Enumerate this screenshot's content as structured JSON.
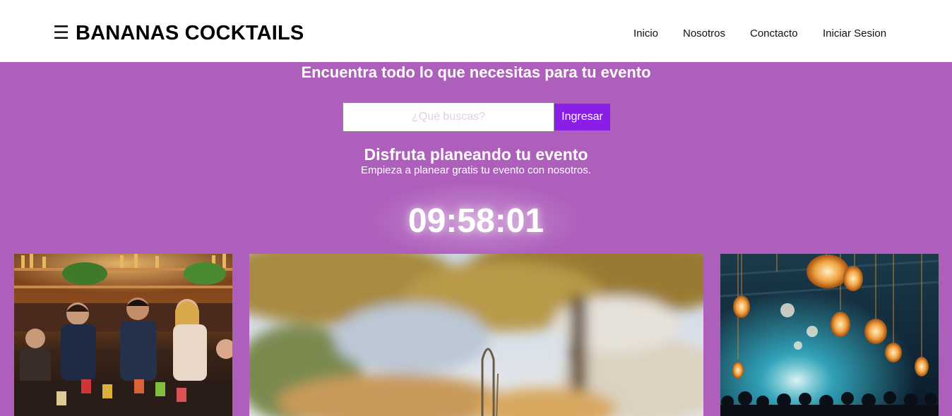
{
  "header": {
    "menu_icon": "hamburger-menu-icon",
    "brand": "BANANAS COCKTAILS",
    "nav": [
      {
        "label": "Inicio"
      },
      {
        "label": "Nosotros"
      },
      {
        "label": "Conctacto"
      },
      {
        "label": "Iniciar Sesion"
      }
    ]
  },
  "hero": {
    "title": "Encuentra todo lo que necesitas para tu evento",
    "search": {
      "placeholder": "¿Qué buscas?",
      "value": "",
      "button_label": "Ingresar"
    },
    "subtitle": "Disfruta planeando tu evento",
    "description": "Empieza a planear gratis tu evento con nosotros.",
    "countdown": "09:58:01"
  },
  "gallery": [
    {
      "alt": "Grupo de amigos brindando con cócteles en un bar"
    },
    {
      "alt": "Exterior con árbol y columpio desenfocado"
    },
    {
      "alt": "Fiesta en salón con luces colgantes y luz azul"
    }
  ],
  "colors": {
    "background": "#ae5fbc",
    "header": "#ffffff",
    "button": "#8a1ee6",
    "text_light": "#ffffff"
  }
}
